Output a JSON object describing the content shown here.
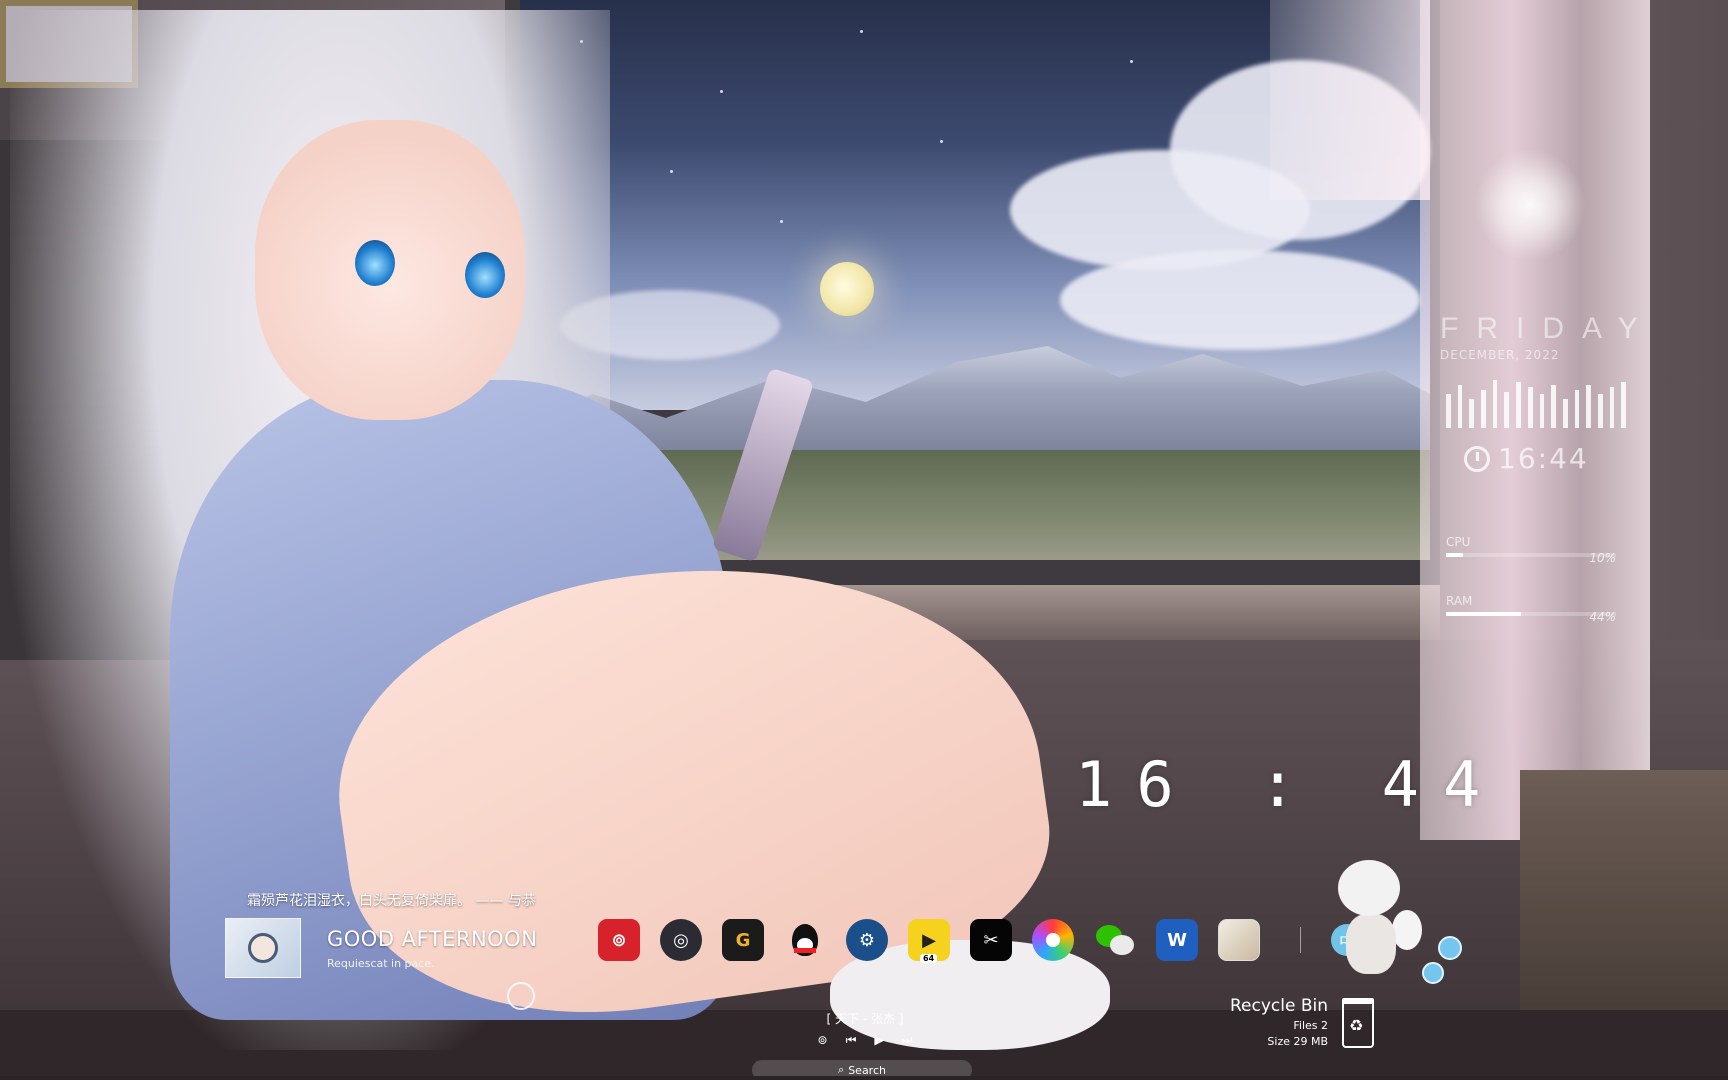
{
  "quote": {
    "text": "霜殒芦花泪湿衣，白头无复倚柴扉。 —— 与恭"
  },
  "greeting": {
    "title": "GOOD AFTERNOON",
    "subtitle": "Requiescat in pace."
  },
  "clock": {
    "time": "16 : 44"
  },
  "side_widget": {
    "day": "FRIDAY",
    "date": "DECEMBER, 2022",
    "time": "16:44",
    "cpu": {
      "label": "CPU",
      "percent": "10%",
      "value": 0.1
    },
    "ram": {
      "label": "RAM",
      "percent": "44%",
      "value": 0.44
    },
    "audio_levels": [
      0.7,
      0.9,
      0.6,
      0.8,
      1.0,
      0.75,
      0.95,
      0.85,
      0.7,
      0.9,
      0.6,
      0.8,
      0.9,
      0.7,
      0.85,
      0.95
    ]
  },
  "dock": {
    "apps": [
      {
        "name": "NetEase Cloud Music",
        "icon": "netease-music-icon",
        "glyph": "⊚"
      },
      {
        "name": "OBS Studio",
        "icon": "obs-icon",
        "glyph": "◎"
      },
      {
        "name": "GeForce App",
        "icon": "g-app-icon",
        "glyph": "G"
      },
      {
        "name": "QQ",
        "icon": "qq-penguin-icon"
      },
      {
        "name": "Steam",
        "icon": "steam-icon",
        "glyph": "⚙"
      },
      {
        "name": "PotPlayer 64",
        "icon": "potplayer-icon",
        "glyph": "▶",
        "badge": "64"
      },
      {
        "name": "CapCut",
        "icon": "capcut-icon",
        "glyph": "✂"
      },
      {
        "name": "Color Launcher",
        "icon": "rainbow-ring-icon"
      },
      {
        "name": "WeChat",
        "icon": "wechat-icon"
      },
      {
        "name": "Word",
        "icon": "word-icon",
        "glyph": "W"
      },
      {
        "name": "Genshin Impact",
        "icon": "genshin-icon"
      }
    ],
    "ime_label": "中"
  },
  "music": {
    "song": "[ 天下 - 张杰 ]",
    "icons": [
      "netease-logo-icon",
      "previous-icon",
      "play-icon",
      "next-icon"
    ]
  },
  "recycle_bin": {
    "title": "Recycle Bin",
    "files": "Files 2",
    "size": "Size 29 MB"
  },
  "search": {
    "label": "Search"
  },
  "colors": {
    "accent": "#6fc4e8",
    "netease": "#d8222b",
    "steam": "#1b4f8a",
    "word": "#1f5fbf"
  }
}
